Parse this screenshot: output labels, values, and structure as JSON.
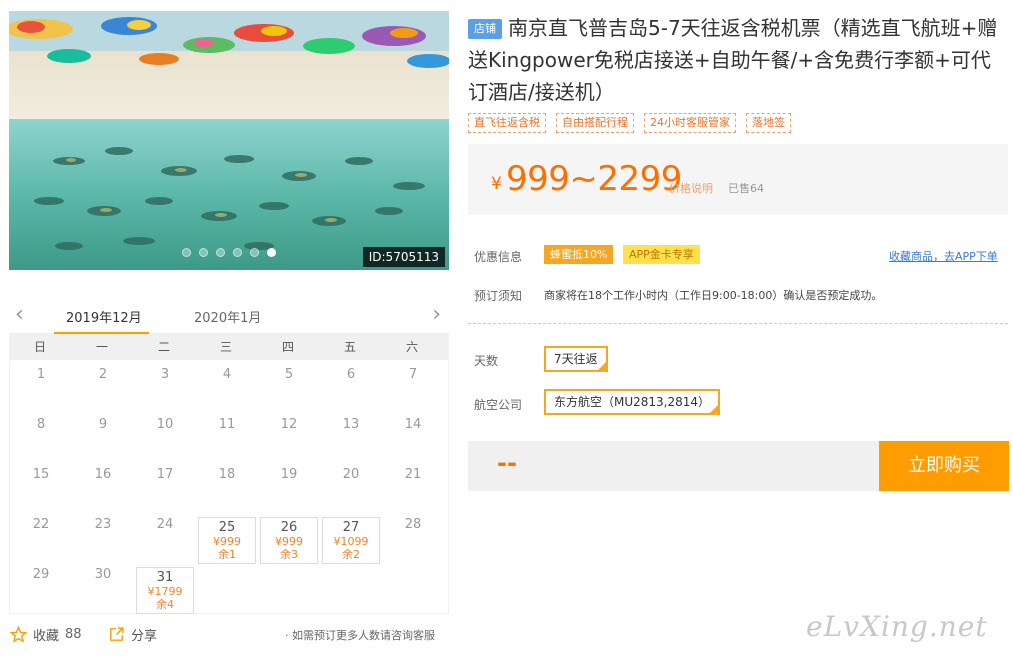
{
  "product": {
    "image_id": "ID:5705113",
    "shop_tag": "店铺",
    "title": "南京直飞普吉岛5-7天往返含税机票（精选直飞航班+赠送Kingpower免税店接送+自助午餐/+含免费行李额+可代订酒店/接送机）",
    "tags": [
      "直飞往返含税",
      "自由搭配行程",
      "24小时客服管家",
      "落地签"
    ]
  },
  "price": {
    "currency": "¥",
    "range": "999~2299",
    "explain": "价格说明",
    "sold": "已售64"
  },
  "offers": {
    "label": "优惠信息",
    "badge1": "蜂蜜抵10%",
    "badge2": "APP金卡专享",
    "app_link": "收藏商品，去APP下单"
  },
  "booking": {
    "label": "预订须知",
    "text": "商家将在18个工作小时内（工作日9:00-18:00）确认是否预定成功。"
  },
  "options": {
    "days_label": "天数",
    "days_value": "7天往返",
    "airline_label": "航空公司",
    "airline_value": "东方航空（MU2813,2814）"
  },
  "purchase": {
    "total": "--",
    "buy_label": "立即购买"
  },
  "calendar": {
    "month_current": "2019年12月",
    "month_next": "2020年1月",
    "weekdays": [
      "日",
      "一",
      "二",
      "三",
      "四",
      "五",
      "六"
    ],
    "days": [
      {
        "d": "1"
      },
      {
        "d": "2"
      },
      {
        "d": "3"
      },
      {
        "d": "4"
      },
      {
        "d": "5"
      },
      {
        "d": "6"
      },
      {
        "d": "7"
      },
      {
        "d": "8"
      },
      {
        "d": "9"
      },
      {
        "d": "10"
      },
      {
        "d": "11"
      },
      {
        "d": "12"
      },
      {
        "d": "13"
      },
      {
        "d": "14"
      },
      {
        "d": "15"
      },
      {
        "d": "16"
      },
      {
        "d": "17"
      },
      {
        "d": "18"
      },
      {
        "d": "19"
      },
      {
        "d": "20"
      },
      {
        "d": "21"
      },
      {
        "d": "22"
      },
      {
        "d": "23"
      },
      {
        "d": "24"
      },
      {
        "d": "25",
        "price": "¥999",
        "remain": "余1"
      },
      {
        "d": "26",
        "price": "¥999",
        "remain": "余3"
      },
      {
        "d": "27",
        "price": "¥1099",
        "remain": "余2"
      },
      {
        "d": "28"
      },
      {
        "d": "29"
      },
      {
        "d": "30"
      },
      {
        "d": "31",
        "price": "¥1799",
        "remain": "余4"
      }
    ]
  },
  "footer": {
    "favorite_label": "收藏",
    "favorite_count": "88",
    "share_label": "分享",
    "note": "· 如需预订更多人数请咨询客服"
  },
  "watermark": "eLvXing.net",
  "colors": {
    "accent": "#ff9d00",
    "price": "#ff6f00",
    "shop_tag": "#5aa0e6",
    "link": "#3a7bd5"
  }
}
